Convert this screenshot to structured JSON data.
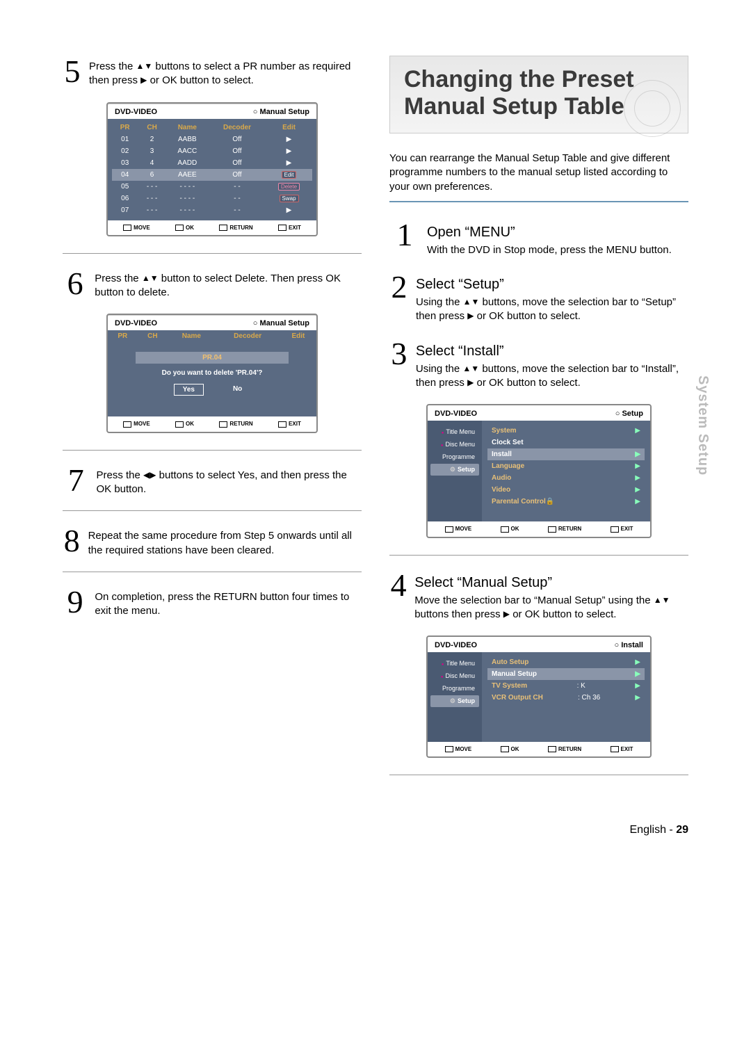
{
  "left": {
    "step5": {
      "text_a": "Press the ",
      "text_b": " buttons to select a PR number as required then press ",
      "text_c": " or OK button to select."
    },
    "osd1": {
      "title_left": "DVD-VIDEO",
      "title_right": "Manual Setup",
      "cols": [
        "PR",
        "CH",
        "Name",
        "Decoder",
        "Edit"
      ],
      "rows": [
        {
          "pr": "01",
          "ch": "2",
          "name": "AABB",
          "dec": "Off",
          "edit": "▶"
        },
        {
          "pr": "02",
          "ch": "3",
          "name": "AACC",
          "dec": "Off",
          "edit": "▶"
        },
        {
          "pr": "03",
          "ch": "4",
          "name": "AADD",
          "dec": "Off",
          "edit": "▶"
        },
        {
          "pr": "04",
          "ch": "6",
          "name": "AAEE",
          "dec": "Off",
          "edit": "Edit",
          "hl": true
        },
        {
          "pr": "05",
          "ch": "- - -",
          "name": "- - - -",
          "dec": "- -",
          "edit": "Delete"
        },
        {
          "pr": "06",
          "ch": "- - -",
          "name": "- - - -",
          "dec": "- -",
          "edit": "Swap"
        },
        {
          "pr": "07",
          "ch": "- - -",
          "name": "- - - -",
          "dec": "- -",
          "edit": "▶"
        }
      ],
      "footer": [
        "MOVE",
        "OK",
        "RETURN",
        "EXIT"
      ]
    },
    "step6": {
      "text_a": "Press the ",
      "text_b": " button to select Delete. Then press OK button to delete."
    },
    "osd2": {
      "title_left": "DVD-VIDEO",
      "title_right": "Manual Setup",
      "cols": [
        "PR",
        "CH",
        "Name",
        "Decoder",
        "Edit"
      ],
      "pr_label": "PR.04",
      "question": "Do you want to delete 'PR.04'?",
      "yes": "Yes",
      "no": "No",
      "footer": [
        "MOVE",
        "OK",
        "RETURN",
        "EXIT"
      ]
    },
    "step7": {
      "text_a": "Press the ",
      "text_b": "buttons to select Yes, and then press the OK button."
    },
    "step8": {
      "text": "Repeat the same procedure from Step 5 onwards until all the required stations have been cleared."
    },
    "step9": {
      "text": "On completion, press the RETURN button four times to exit the menu."
    }
  },
  "right": {
    "banner_l1": "Changing the Preset",
    "banner_l2": "Manual Setup Table",
    "intro": "You can rearrange the Manual Setup Table and give different programme numbers to the manual setup listed according to your own preferences.",
    "step1": {
      "title": "Open “MENU”",
      "desc": "With the DVD in Stop mode, press the MENU button."
    },
    "step2": {
      "title": "Select “Setup”",
      "desc_a": "Using the ",
      "desc_b": " buttons, move the selection bar to “Setup” then press ",
      "desc_c": " or OK button to select."
    },
    "step3": {
      "title": "Select “Install”",
      "desc_a": "Using the ",
      "desc_b": " buttons, move the selection bar to “Install”, then press ",
      "desc_c": " or OK button to select."
    },
    "osd_setup": {
      "title_left": "DVD-VIDEO",
      "title_right": "Setup",
      "side": [
        "Title Menu",
        "Disc Menu",
        "Programme",
        "Setup"
      ],
      "items": [
        {
          "label": "System"
        },
        {
          "label": "Clock Set"
        },
        {
          "label": "Install",
          "sel": true
        },
        {
          "label": "Language"
        },
        {
          "label": "Audio"
        },
        {
          "label": "Video"
        },
        {
          "label": "Parental Control",
          "lock": true
        }
      ],
      "footer": [
        "MOVE",
        "OK",
        "RETURN",
        "EXIT"
      ]
    },
    "step4": {
      "title": "Select “Manual Setup”",
      "desc_a": "Move the selection bar to “Manual Setup” using the ",
      "desc_b": "buttons then press ",
      "desc_c": " or OK button to select."
    },
    "osd_install": {
      "title_left": "DVD-VIDEO",
      "title_right": "Install",
      "side": [
        "Title Menu",
        "Disc Menu",
        "Programme",
        "Setup"
      ],
      "items": [
        {
          "label": "Auto Setup",
          "val": ""
        },
        {
          "label": "Manual Setup",
          "val": "",
          "sel": true
        },
        {
          "label": "TV System",
          "val": ": K"
        },
        {
          "label": "VCR Output CH",
          "val": ": Ch 36"
        }
      ],
      "footer": [
        "MOVE",
        "OK",
        "RETURN",
        "EXIT"
      ]
    }
  },
  "side_tab": "System Setup",
  "footer_lang": "English -",
  "footer_page": "29"
}
